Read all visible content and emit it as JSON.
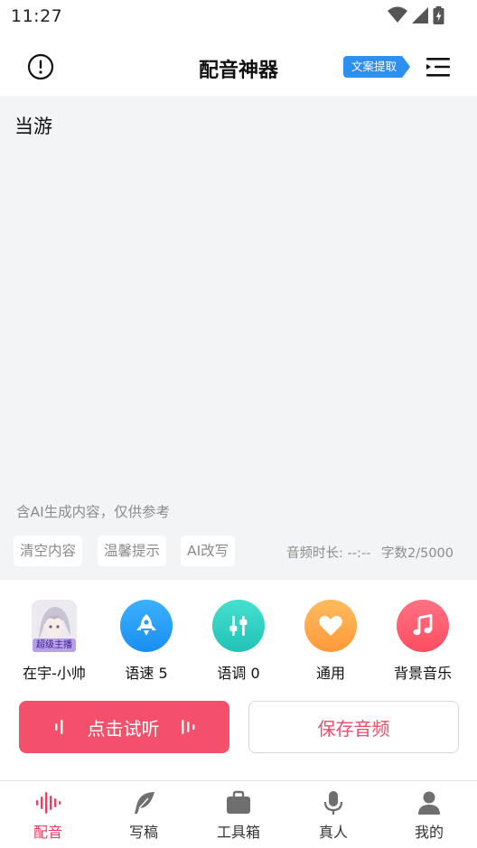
{
  "status_bar": {
    "time": "11:27"
  },
  "header": {
    "title": "配音神器",
    "extract_label": "文案提取"
  },
  "editor": {
    "content": "当游",
    "ai_note": "含AI生成内容，仅供参考",
    "chips": [
      "清空内容",
      "温馨提示",
      "AI改写"
    ],
    "duration": "音频时长: --:--",
    "word_count": "字数2/5000"
  },
  "voice_options": {
    "anchor_badge": "超级主播",
    "anchor_name": "在宇-小帅",
    "speed": "语速 5",
    "tone": "语调 0",
    "style": "通用",
    "bgm": "背景音乐"
  },
  "actions": {
    "preview_label": "点击试听",
    "save_label": "保存音频"
  },
  "bottom_nav": [
    {
      "label": "配音",
      "icon": "soundwave-icon",
      "active": true
    },
    {
      "label": "写稿",
      "icon": "feather-icon",
      "active": false
    },
    {
      "label": "工具箱",
      "icon": "briefcase-icon",
      "active": false
    },
    {
      "label": "真人",
      "icon": "microphone-icon",
      "active": false
    },
    {
      "label": "我的",
      "icon": "user-icon",
      "active": false
    }
  ],
  "colors": {
    "accent": "#f5506b",
    "extract_blue": "#2d8ff0",
    "speed_blue": "#1f9bf3",
    "tone_teal": "#2fd3c6",
    "style_orange": "#ffa545",
    "bgm_red": "#ff5c6e"
  }
}
